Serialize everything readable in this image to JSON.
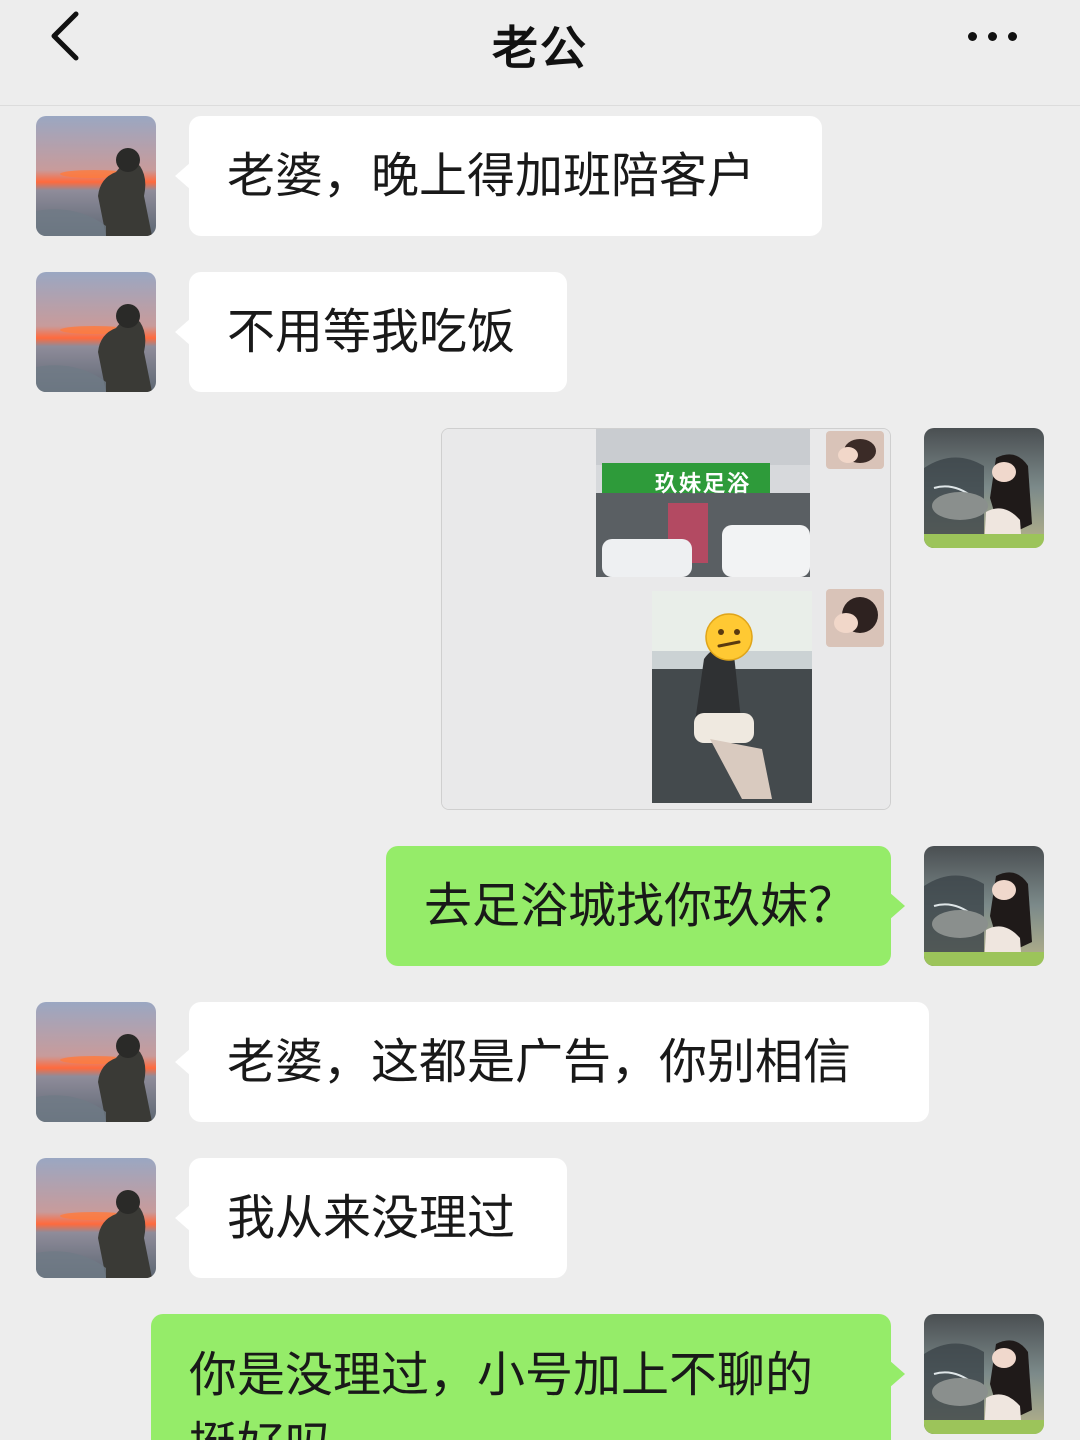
{
  "header": {
    "title": "老公"
  },
  "messages": [
    {
      "side": "left",
      "text": "老婆，晚上得加班陪客户"
    },
    {
      "side": "left",
      "text": "不用等我吃饭"
    },
    {
      "side": "right",
      "type": "image",
      "sign_text": "玖妹足浴"
    },
    {
      "side": "right",
      "text": "去足浴城找你玖妹？"
    },
    {
      "side": "left",
      "text": "老婆，这都是广告，你别相信"
    },
    {
      "side": "left",
      "text": "我从来没理过"
    },
    {
      "side": "right",
      "text": "你是没理过，小号加上不聊的挺好吗"
    }
  ],
  "icons": {
    "back": "chevron-left-icon",
    "more": "more-horizontal-icon",
    "sticker": "confused-face-emoji"
  },
  "colors": {
    "background": "#ededed",
    "incoming_bubble": "#ffffff",
    "outgoing_bubble": "#95ec69",
    "sign_green": "#2e9b3a"
  }
}
